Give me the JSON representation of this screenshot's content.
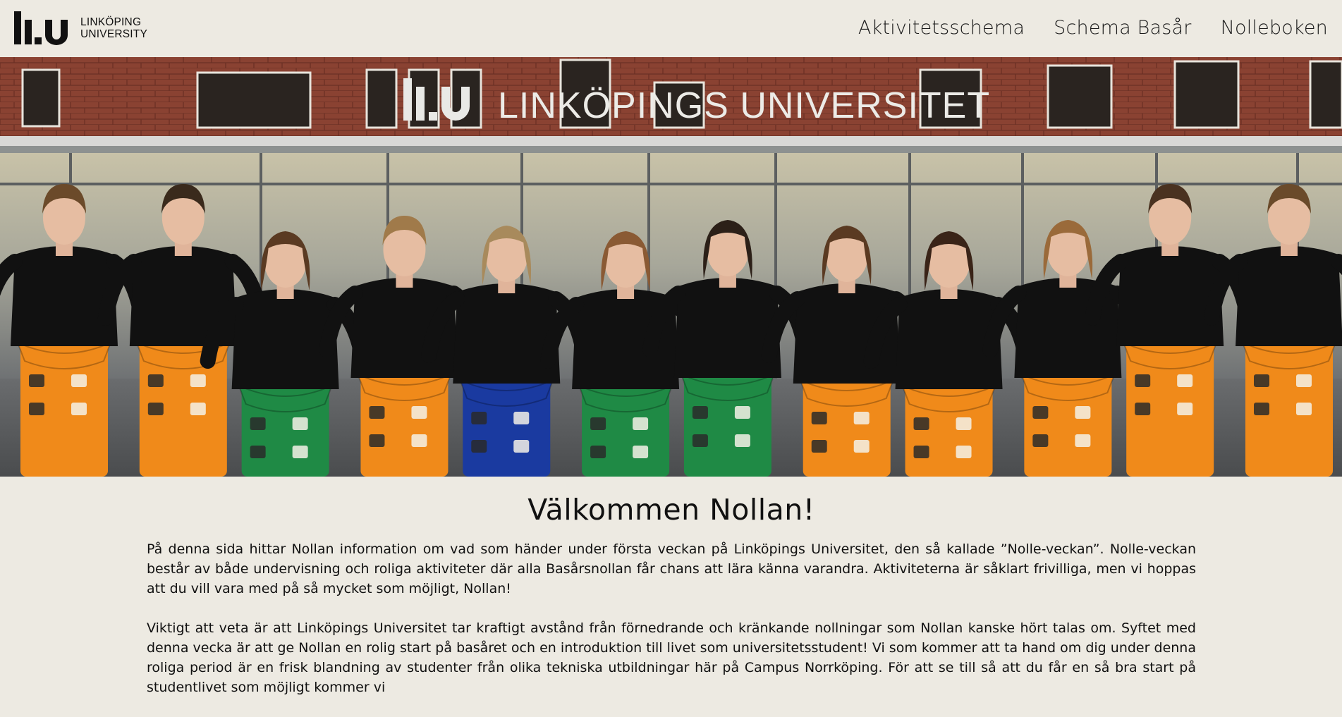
{
  "header": {
    "logo": {
      "line1": "LINKÖPING",
      "line2": "UNIVERSITY"
    },
    "nav": [
      {
        "label": "Aktivitetsschema"
      },
      {
        "label": "Schema Basår"
      },
      {
        "label": "Nolleboken"
      }
    ]
  },
  "hero": {
    "sign_text": "LINKÖPINGS UNIVERSITET",
    "people_count": 12,
    "colors": {
      "brick": "#8a4232",
      "glass": "#9aa0a0",
      "shirt": "#111111",
      "orange": "#f08a1a",
      "green": "#1f8a45",
      "blue": "#1a3aa0"
    }
  },
  "main": {
    "title": "Välkommen Nollan!",
    "paragraphs": [
      "På denna sida hittar Nollan information om vad som händer under första veckan på Linköpings Universitet, den så kallade ”Nolle-veckan”. Nolle-veckan består av både undervisning och roliga aktiviteter där alla Basårsnollan får chans att lära känna varandra. Aktiviteterna är såklart frivilliga, men vi hoppas att du vill vara med på så mycket som möjligt, Nollan!",
      "Viktigt att veta är att Linköpings Universitet tar kraftigt avstånd från förnedrande och kränkande nollningar som Nollan kanske hört talas om. Syftet med denna vecka är att ge Nollan en rolig start på basåret och en introduktion till livet som universitetsstudent! Vi som kommer att ta hand om dig under denna roliga period är en frisk blandning av studenter från olika tekniska utbildningar här på Campus Norrköping. För att se till så att du får en så bra start på studentlivet som möjligt kommer vi"
    ]
  }
}
